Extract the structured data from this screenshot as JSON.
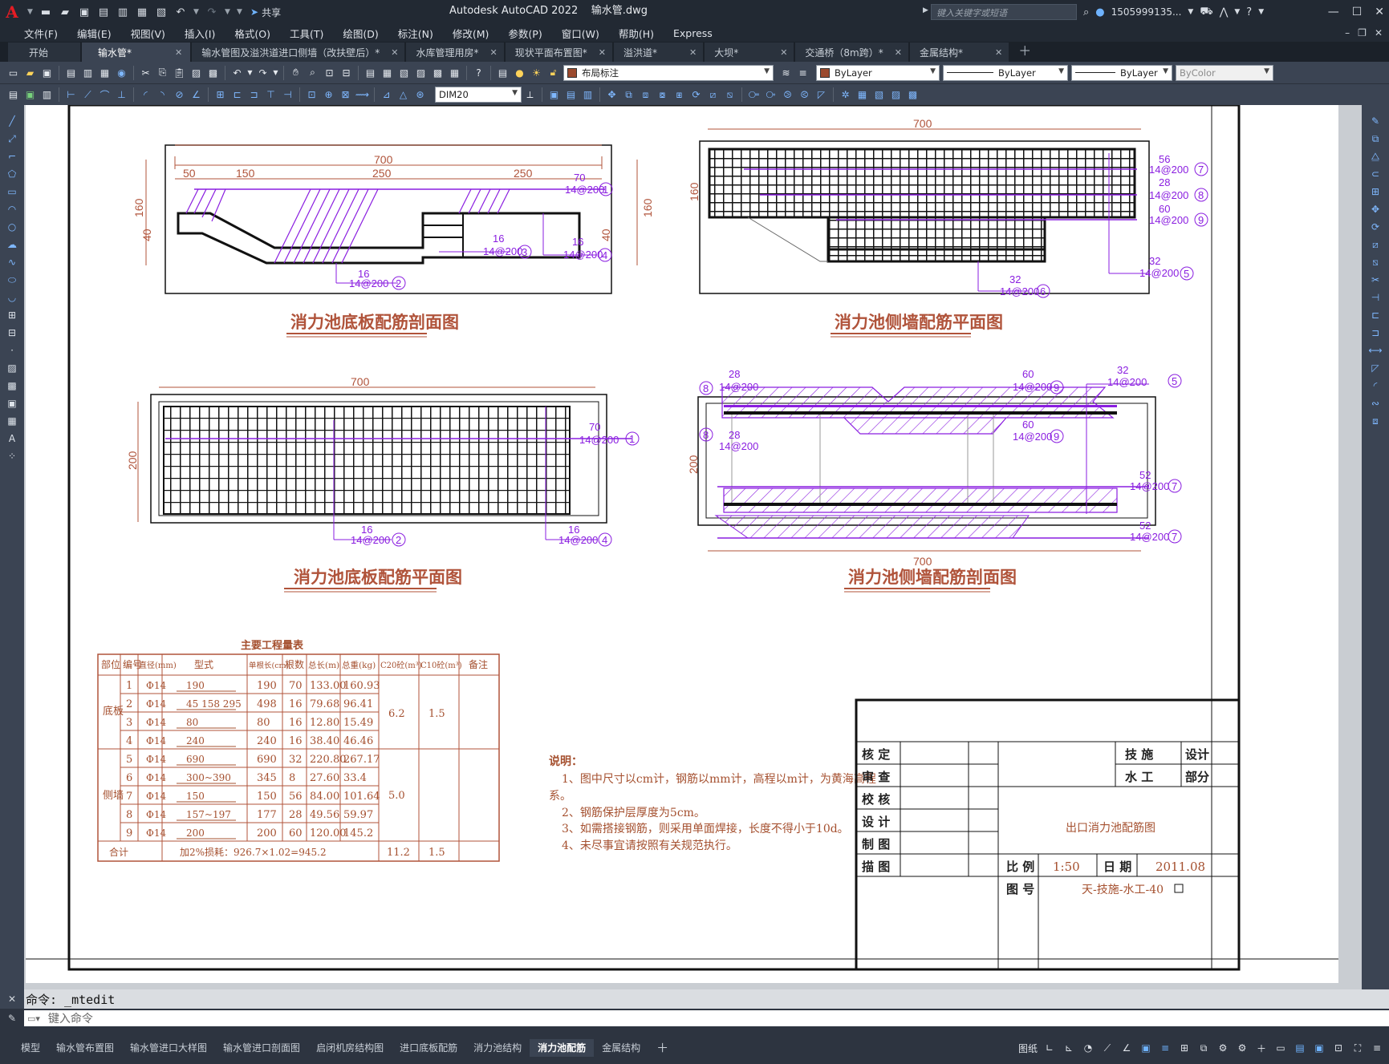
{
  "app": {
    "logo": "A",
    "title": "Autodesk AutoCAD 2022    输水管.dwg",
    "search_placeholder": "键入关键字或短语",
    "user": "1505999135...",
    "share_label": "共享"
  },
  "menu": [
    "文件(F)",
    "编辑(E)",
    "视图(V)",
    "插入(I)",
    "格式(O)",
    "工具(T)",
    "绘图(D)",
    "标注(N)",
    "修改(M)",
    "参数(P)",
    "窗口(W)",
    "帮助(H)",
    "Express"
  ],
  "file_tabs": [
    {
      "label": "开始"
    },
    {
      "label": "输水管*"
    },
    {
      "label": "输水管图及溢洪道进口侧墙（改扶壁后）*"
    },
    {
      "label": "水库管理用房*"
    },
    {
      "label": "现状平面布置图*"
    },
    {
      "label": "溢洪道*"
    },
    {
      "label": "大坝*"
    },
    {
      "label": "交通桥（8m跨）*"
    },
    {
      "label": "金属结构*"
    }
  ],
  "toolbar": {
    "layer": "布局标注",
    "color": "ByLayer",
    "linetype": "ByLayer",
    "lineweight": "ByLayer",
    "plotstyle": "ByColor",
    "dimstyle": "DIM20"
  },
  "drawing": {
    "views": {
      "v1_title": "消力池底板配筋剖面图",
      "v2_title": "消力池侧墙配筋平面图",
      "v3_title": "消力池底板配筋平面图",
      "v4_title": "消力池侧墙配筋剖面图"
    },
    "dims": {
      "d700": "700",
      "d50": "50",
      "d150": "150",
      "d250": "250",
      "d160": "160",
      "d40": "40",
      "d200": "200"
    },
    "rebar": {
      "r70": "70",
      "r16": "16",
      "r56": "56",
      "r28": "28",
      "r60": "60",
      "r32": "32",
      "r52": "52",
      "spec": "14@200",
      "phi": "Φ",
      "n1": "1",
      "n2": "2",
      "n3": "3",
      "n4": "4",
      "n5": "5",
      "n6": "6",
      "n7": "7",
      "n8": "8",
      "n9": "9"
    },
    "table": {
      "title": "主要工程量表",
      "headers": [
        "部位",
        "编号",
        "直径(mm)",
        "型式",
        "单根长(cm)",
        "根数",
        "总长(m)",
        "总重(kg)",
        "C20砼(m³)",
        "C10砼(m³)",
        "备注"
      ],
      "part_floor": "底板",
      "part_wall": "侧墙",
      "rows": [
        {
          "no": "1",
          "dia": "Φ14",
          "shape": "190",
          "len": "190",
          "cnt": "70",
          "tlen": "133.00",
          "wt": "160.93"
        },
        {
          "no": "2",
          "dia": "Φ14",
          "shape": "45  158  295",
          "len": "498",
          "cnt": "16",
          "tlen": "79.68",
          "wt": "96.41"
        },
        {
          "no": "3",
          "dia": "Φ14",
          "shape": "80",
          "len": "80",
          "cnt": "16",
          "tlen": "12.80",
          "wt": "15.49"
        },
        {
          "no": "4",
          "dia": "Φ14",
          "shape": "240",
          "len": "240",
          "cnt": "16",
          "tlen": "38.40",
          "wt": "46.46"
        },
        {
          "no": "5",
          "dia": "Φ14",
          "shape": "690",
          "len": "690",
          "cnt": "32",
          "tlen": "220.80",
          "wt": "267.17"
        },
        {
          "no": "6",
          "dia": "Φ14",
          "shape": "300~390",
          "len": "345",
          "cnt": "8",
          "tlen": "27.60",
          "wt": "33.4"
        },
        {
          "no": "7",
          "dia": "Φ14",
          "shape": "150",
          "len": "150",
          "cnt": "56",
          "tlen": "84.00",
          "wt": "101.64"
        },
        {
          "no": "8",
          "dia": "Φ14",
          "shape": "157~197",
          "len": "177",
          "cnt": "28",
          "tlen": "49.56",
          "wt": "59.97"
        },
        {
          "no": "9",
          "dia": "Φ14",
          "shape": "200",
          "len": "200",
          "cnt": "60",
          "tlen": "120.00",
          "wt": "145.2"
        }
      ],
      "c20_floor": "6.2",
      "c10_floor": "1.5",
      "c20_wall": "5.0",
      "total_label": "合计",
      "total_formula": "加2%损耗：926.7×1.02=945.2",
      "total_c20": "11.2",
      "total_c10": "1.5"
    },
    "notes": {
      "head": "说明：",
      "n1a": "1、图中尺寸以cm计，钢筋以mm计，高程以m计，为黄海高程",
      "n1b": "系。",
      "n2": "2、钢筋保护层厚度为5cm。",
      "n3": "3、如需搭接钢筋，则采用单面焊接，长度不得小于10d。",
      "n4": "4、未尽事宜请按照有关规范执行。"
    },
    "titleblock": {
      "r1": "核  定",
      "r2": "审  查",
      "r3": "校  核",
      "r4": "设  计",
      "r5": "制  图",
      "r6": "描  图",
      "org1": "技  施",
      "org2": "水  工",
      "stage1": "设计",
      "stage2": "部分",
      "name": "出口消力池配筋图",
      "scale_label": "比  例",
      "scale": "1:50",
      "date_label": "日  期",
      "date": "2011.08",
      "no_label": "图  号",
      "no": "天-技施-水工-40"
    }
  },
  "command": {
    "history": "命令:  _mtedit",
    "placeholder": "键入命令"
  },
  "layout_tabs": [
    "模型",
    "输水管布置图",
    "输水管进口大样图",
    "输水管进口剖面图",
    "启闭机房结构图",
    "进口底板配筋",
    "消力池结构",
    "消力池配筋",
    "金属结构"
  ],
  "active_layout": "消力池配筋",
  "status": {
    "paper": "图纸"
  }
}
